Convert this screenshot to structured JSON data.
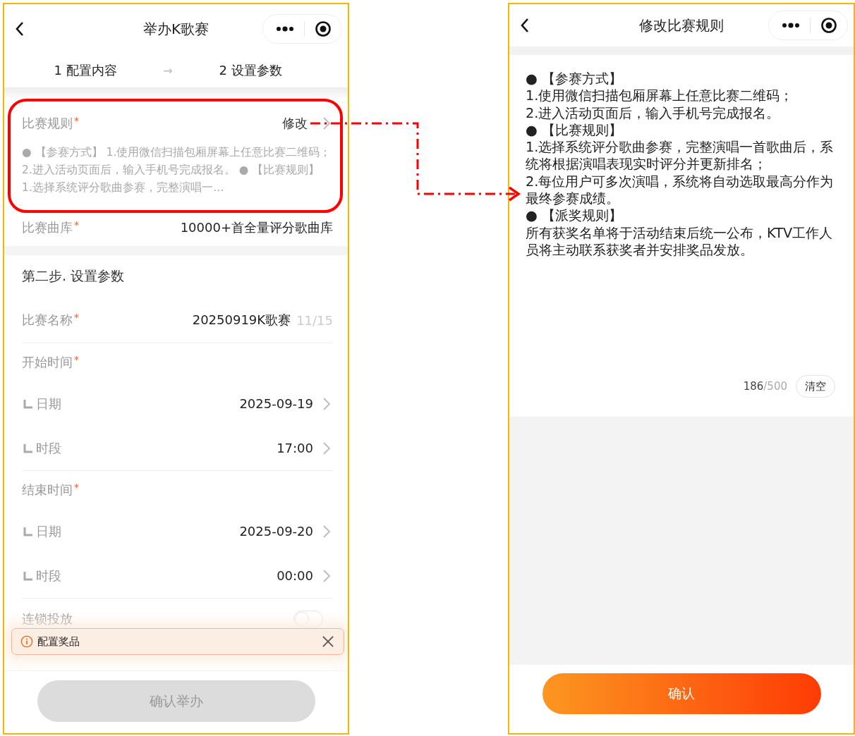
{
  "left_screen": {
    "nav": {
      "title": "举办K歌赛"
    },
    "steps": [
      {
        "label": "1 配置内容"
      },
      {
        "label": "2 设置参数"
      }
    ],
    "step_separator": "→",
    "rules": {
      "label": "比赛规则",
      "required_mark": "*",
      "action": "修改",
      "summary": "●  【参赛方式】 1.使用微信扫描包厢屏幕上任意比赛二维码； 2.进入活动页面后，输入手机号完成报名。 ●  【比赛规则】 1.选择系统评分歌曲参赛，完整演唱一…"
    },
    "library": {
      "label": "比赛曲库",
      "required_mark": "*",
      "value": "10000+首全量评分歌曲库"
    },
    "section_title": "第二步. 设置参数",
    "fields": [
      {
        "kind": "input",
        "label": "比赛名称",
        "required_mark": "*",
        "value": "20250919K歌赛",
        "counter": "11/15"
      },
      {
        "kind": "group",
        "label": "开始时间",
        "required_mark": "*",
        "children": [
          {
            "label": "日期",
            "value": "2025-09-19"
          },
          {
            "label": "时段",
            "value": "17:00"
          }
        ]
      },
      {
        "kind": "group",
        "label": "结束时间",
        "required_mark": "*",
        "children": [
          {
            "label": "日期",
            "value": "2025-09-20"
          },
          {
            "label": "时段",
            "value": "00:00"
          }
        ]
      },
      {
        "kind": "switch",
        "label": "连锁投放",
        "on": false
      }
    ],
    "toast": {
      "text": "配置奖品"
    },
    "submit_button": {
      "label": "确认举办",
      "disabled": true
    }
  },
  "right_screen": {
    "nav": {
      "title": "修改比赛规则"
    },
    "rules_text": [
      "●  【参赛方式】",
      "1.使用微信扫描包厢屏幕上任意比赛二维码；",
      "2.进入活动页面后，输入手机号完成报名。",
      "●  【比赛规则】",
      "1.选择系统评分歌曲参赛，完整演唱一首歌曲后，系统将根据演唱表现实时评分并更新排名；",
      "2.每位用户可多次演唱，系统将自动选取最高分作为最终参赛成绩。",
      "●  【派奖规则】",
      "所有获奖名单将于活动结束后统一公布，KTV工作人员将主动联系获奖者并安排奖品发放。"
    ],
    "counter": {
      "count": "186",
      "limit": "/500"
    },
    "clear_button": "清空",
    "confirm_button": {
      "label": "确认"
    }
  }
}
